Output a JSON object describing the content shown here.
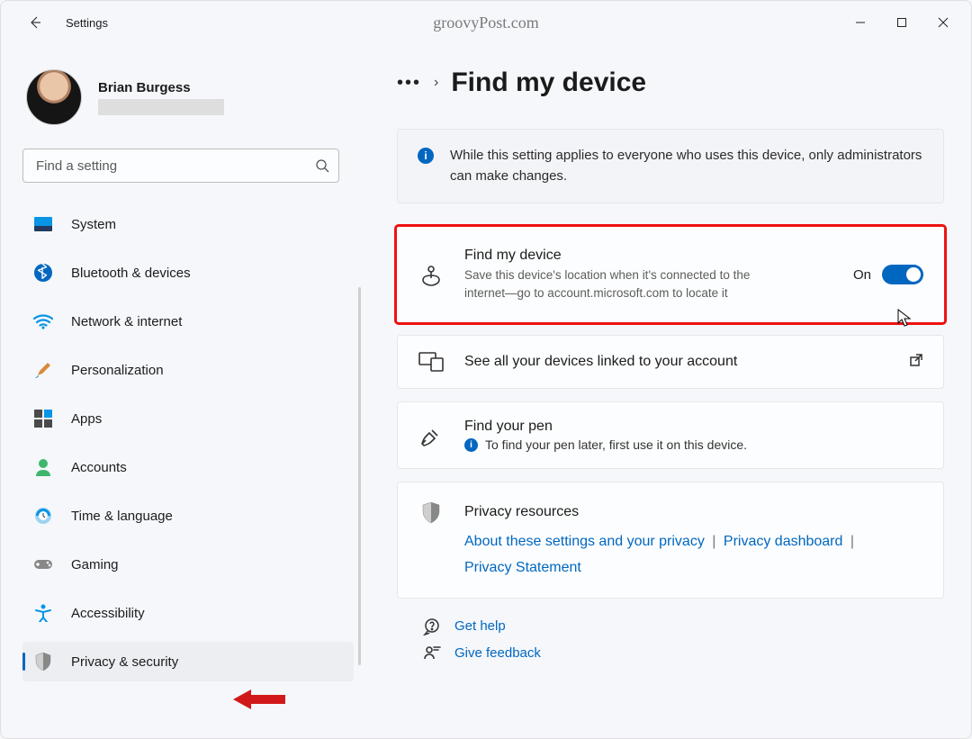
{
  "app": {
    "title": "Settings",
    "watermark": "groovyPost.com"
  },
  "user": {
    "name": "Brian Burgess"
  },
  "search": {
    "placeholder": "Find a setting"
  },
  "nav": {
    "items": [
      {
        "label": "System",
        "icon": "system-icon"
      },
      {
        "label": "Bluetooth & devices",
        "icon": "bluetooth-icon"
      },
      {
        "label": "Network & internet",
        "icon": "wifi-icon"
      },
      {
        "label": "Personalization",
        "icon": "brush-icon"
      },
      {
        "label": "Apps",
        "icon": "apps-icon"
      },
      {
        "label": "Accounts",
        "icon": "accounts-icon"
      },
      {
        "label": "Time & language",
        "icon": "time-icon"
      },
      {
        "label": "Gaming",
        "icon": "gaming-icon"
      },
      {
        "label": "Accessibility",
        "icon": "accessibility-icon"
      },
      {
        "label": "Privacy & security",
        "icon": "shield-icon"
      }
    ],
    "active_index": 9
  },
  "breadcrumb": {
    "page_title": "Find my device"
  },
  "notice": {
    "text": "While this setting applies to everyone who uses this device, only administrators can make changes."
  },
  "cards": {
    "find_device": {
      "title": "Find my device",
      "desc": "Save this device's location when it's connected to the internet—go to account.microsoft.com to locate it",
      "toggle_label": "On",
      "toggle_on": true
    },
    "see_all": {
      "title": "See all your devices linked to your account"
    },
    "pen": {
      "title": "Find your pen",
      "desc": "To find your pen later, first use it on this device."
    },
    "privacy": {
      "title": "Privacy resources",
      "link1": "About these settings and your privacy",
      "link2": "Privacy dashboard",
      "link3": "Privacy Statement"
    }
  },
  "footer": {
    "help": "Get help",
    "feedback": "Give feedback"
  }
}
